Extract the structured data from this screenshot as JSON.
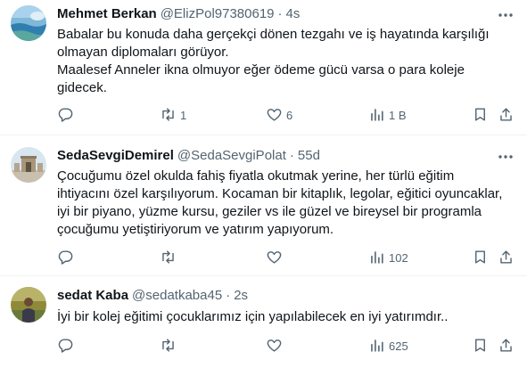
{
  "tweets": [
    {
      "name": "Mehmet Berkan",
      "handle": "@ElizPol97380619",
      "separator": "·",
      "time": "4s",
      "text": "Babalar bu konuda daha gerçekçi dönen tezgahı ve iş hayatında karşılığı\nolmayan diplomaları görüyor.\nMaalesef Anneler ikna olmuyor eğer ödeme gücü varsa o para koleje\ngidecek.",
      "reply_count": "",
      "retweet_count": "1",
      "like_count": "6",
      "view_count": "1 B"
    },
    {
      "name": "SedaSevgiDemirel",
      "handle": "@SedaSevgiPolat",
      "separator": "·",
      "time": "55d",
      "text": "Çocuğumu özel okulda fahiş fiyatla okutmak yerine, her türlü eğitim\nihtiyacını özel karşılıyorum. Kocaman bir kitaplık, legolar, eğitici oyuncaklar,\niyi bir piyano, yüzme kursu, geziler vs ile güzel ve bireysel bir programla\nçocuğumu yetiştiriyorum ve yatırım yapıyorum.",
      "reply_count": "",
      "retweet_count": "",
      "like_count": "",
      "view_count": "102"
    },
    {
      "name": "sedat Kaba",
      "handle": "@sedatkaba45",
      "separator": "·",
      "time": "2s",
      "text": "İyi bir kolej eğitimi çocuklarımız için yapılabilecek en iyi yatırımdır..",
      "reply_count": "",
      "retweet_count": "",
      "like_count": "",
      "view_count": "625"
    }
  ],
  "icons": {
    "more": "more-horizontal-icon",
    "reply": "reply-icon",
    "retweet": "retweet-icon",
    "like": "heart-icon",
    "views": "views-chart-icon",
    "bookmark": "bookmark-icon",
    "share": "share-icon"
  },
  "colors": {
    "text": "#0f1419",
    "secondary": "#536471",
    "divider": "#eff3f4",
    "background": "#ffffff"
  }
}
